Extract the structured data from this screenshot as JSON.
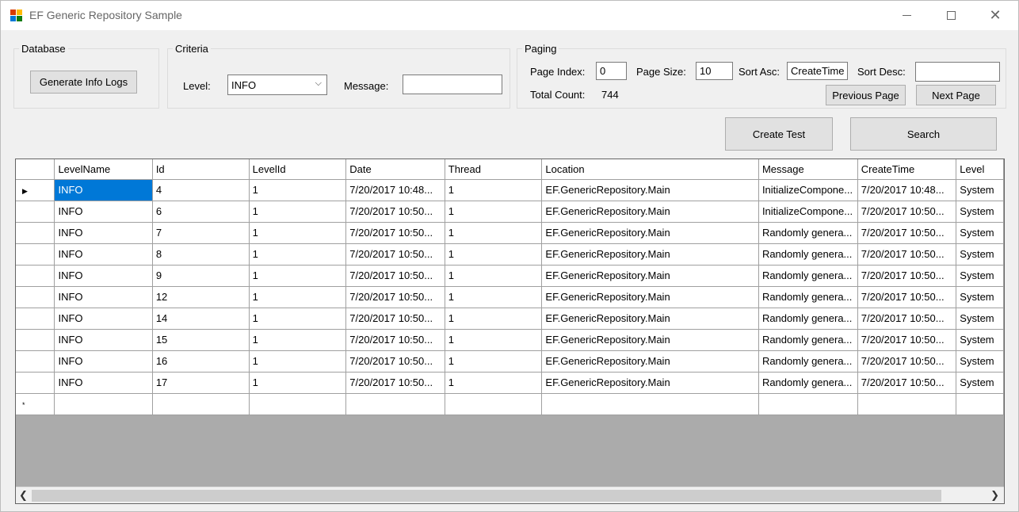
{
  "window": {
    "title": "EF Generic Repository Sample"
  },
  "database": {
    "legend": "Database",
    "generate_label": "Generate Info Logs"
  },
  "criteria": {
    "legend": "Criteria",
    "level_label": "Level:",
    "level_value": "INFO",
    "message_label": "Message:",
    "message_value": ""
  },
  "paging": {
    "legend": "Paging",
    "page_index_label": "Page Index:",
    "page_index_value": "0",
    "page_size_label": "Page Size:",
    "page_size_value": "10",
    "sort_asc_label": "Sort Asc:",
    "sort_asc_value": "CreateTime",
    "sort_desc_label": "Sort Desc:",
    "sort_desc_value": "",
    "total_count_label": "Total Count:",
    "total_count_value": "744",
    "prev_label": "Previous Page",
    "next_label": "Next Page"
  },
  "actions": {
    "create_test_label": "Create Test",
    "search_label": "Search"
  },
  "grid": {
    "columns": [
      "LevelName",
      "Id",
      "LevelId",
      "Date",
      "Thread",
      "Location",
      "Message",
      "CreateTime",
      "Level"
    ],
    "rows": [
      [
        "INFO",
        "4",
        "1",
        "7/20/2017 10:48...",
        "1",
        "EF.GenericRepository.Main",
        "InitializeCompone...",
        "7/20/2017 10:48...",
        "System"
      ],
      [
        "INFO",
        "6",
        "1",
        "7/20/2017 10:50...",
        "1",
        "EF.GenericRepository.Main",
        "InitializeCompone...",
        "7/20/2017 10:50...",
        "System"
      ],
      [
        "INFO",
        "7",
        "1",
        "7/20/2017 10:50...",
        "1",
        "EF.GenericRepository.Main",
        "Randomly genera...",
        "7/20/2017 10:50...",
        "System"
      ],
      [
        "INFO",
        "8",
        "1",
        "7/20/2017 10:50...",
        "1",
        "EF.GenericRepository.Main",
        "Randomly genera...",
        "7/20/2017 10:50...",
        "System"
      ],
      [
        "INFO",
        "9",
        "1",
        "7/20/2017 10:50...",
        "1",
        "EF.GenericRepository.Main",
        "Randomly genera...",
        "7/20/2017 10:50...",
        "System"
      ],
      [
        "INFO",
        "12",
        "1",
        "7/20/2017 10:50...",
        "1",
        "EF.GenericRepository.Main",
        "Randomly genera...",
        "7/20/2017 10:50...",
        "System"
      ],
      [
        "INFO",
        "14",
        "1",
        "7/20/2017 10:50...",
        "1",
        "EF.GenericRepository.Main",
        "Randomly genera...",
        "7/20/2017 10:50...",
        "System"
      ],
      [
        "INFO",
        "15",
        "1",
        "7/20/2017 10:50...",
        "1",
        "EF.GenericRepository.Main",
        "Randomly genera...",
        "7/20/2017 10:50...",
        "System"
      ],
      [
        "INFO",
        "16",
        "1",
        "7/20/2017 10:50...",
        "1",
        "EF.GenericRepository.Main",
        "Randomly genera...",
        "7/20/2017 10:50...",
        "System"
      ],
      [
        "INFO",
        "17",
        "1",
        "7/20/2017 10:50...",
        "1",
        "EF.GenericRepository.Main",
        "Randomly genera...",
        "7/20/2017 10:50...",
        "System"
      ]
    ],
    "current_row_marker": "▶",
    "new_row_marker": "*"
  },
  "colors": {
    "selection": "#0078d7",
    "grid_background": "#ababab"
  }
}
